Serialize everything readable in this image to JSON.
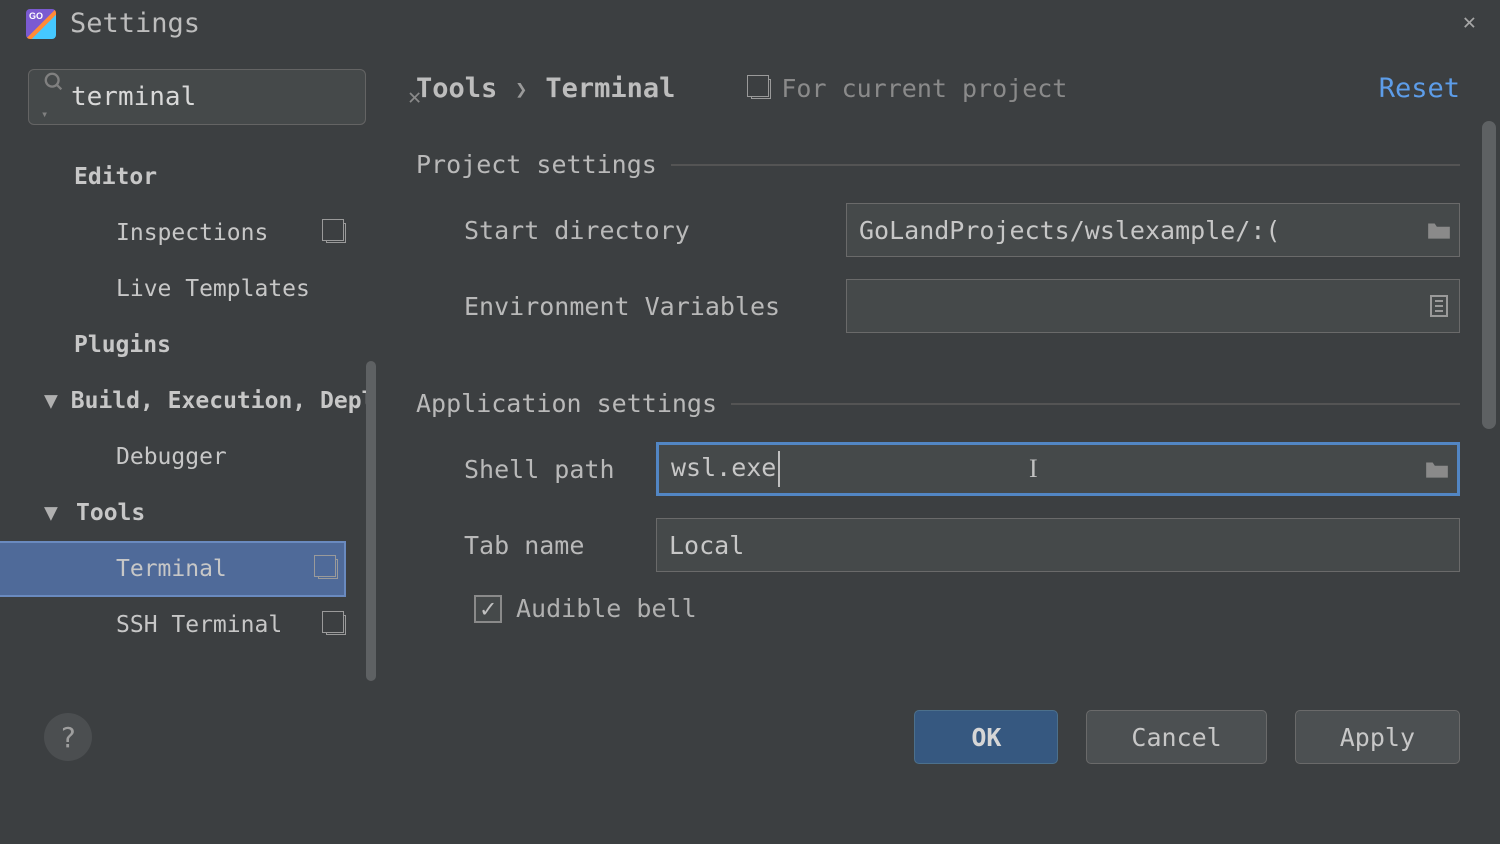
{
  "app": {
    "title": "Settings"
  },
  "search": {
    "value": "terminal"
  },
  "sidebar": {
    "items": [
      {
        "label": "Editor"
      },
      {
        "label": "Inspections"
      },
      {
        "label": "Live Templates"
      },
      {
        "label": "Plugins"
      },
      {
        "label": "Build, Execution, Deployment"
      },
      {
        "label": "Debugger"
      },
      {
        "label": "Tools"
      },
      {
        "label": "Terminal"
      },
      {
        "label": "SSH Terminal"
      }
    ]
  },
  "breadcrumb": {
    "root": "Tools",
    "leaf": "Terminal"
  },
  "scope": {
    "text": "For current project"
  },
  "actions": {
    "reset": "Reset"
  },
  "sections": {
    "project": {
      "title": "Project settings",
      "start_dir": {
        "label": "Start directory",
        "value": "):/GoLandProjects/wslexample"
      },
      "env": {
        "label": "Environment Variables",
        "value": ""
      }
    },
    "app": {
      "title": "Application settings",
      "shell": {
        "label": "Shell path",
        "value": "wsl.exe"
      },
      "tab": {
        "label": "Tab name",
        "value": "Local"
      },
      "bell": {
        "label": "Audible bell",
        "checked": true
      }
    }
  },
  "footer": {
    "ok": "OK",
    "cancel": "Cancel",
    "apply": "Apply"
  }
}
